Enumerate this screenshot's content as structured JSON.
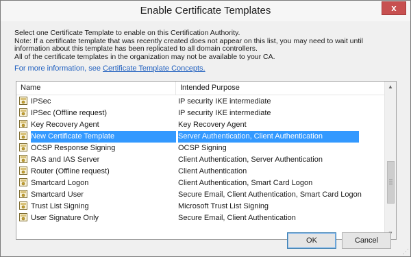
{
  "window": {
    "title": "Enable Certificate Templates",
    "close_glyph": "x"
  },
  "description": {
    "line1": "Select one Certificate Template to enable on this Certification Authority.",
    "line2": "Note: If a certificate template that was recently created does not appear on this list, you may need to wait until",
    "line3": "information about this template has been replicated to all domain controllers.",
    "line4": "All of the certificate templates in the organization may not be available to your CA.",
    "more_info_prefix": "For more information, see",
    "more_info_link": "Certificate Template Concepts."
  },
  "list": {
    "columns": {
      "name": "Name",
      "purpose": "Intended Purpose"
    },
    "selected_index": 3,
    "rows": [
      {
        "name": "IPSec",
        "purpose": "IP security IKE intermediate"
      },
      {
        "name": "IPSec (Offline request)",
        "purpose": "IP security IKE intermediate"
      },
      {
        "name": "Key Recovery Agent",
        "purpose": "Key Recovery Agent"
      },
      {
        "name": "New Certificate Template",
        "purpose": "Server Authentication, Client Authentication"
      },
      {
        "name": "OCSP Response Signing",
        "purpose": "OCSP Signing"
      },
      {
        "name": "RAS and IAS Server",
        "purpose": "Client Authentication, Server Authentication"
      },
      {
        "name": "Router (Offline request)",
        "purpose": "Client Authentication"
      },
      {
        "name": "Smartcard Logon",
        "purpose": "Client Authentication, Smart Card Logon"
      },
      {
        "name": "Smartcard User",
        "purpose": "Secure Email, Client Authentication, Smart Card Logon"
      },
      {
        "name": "Trust List Signing",
        "purpose": "Microsoft Trust List Signing"
      },
      {
        "name": "User Signature Only",
        "purpose": "Secure Email, Client Authentication"
      }
    ],
    "row_icon": "certificate-template-icon"
  },
  "buttons": {
    "ok": "OK",
    "cancel": "Cancel"
  },
  "colors": {
    "selection": "#3399ff",
    "link": "#1f5fbf",
    "close": "#c75050"
  }
}
